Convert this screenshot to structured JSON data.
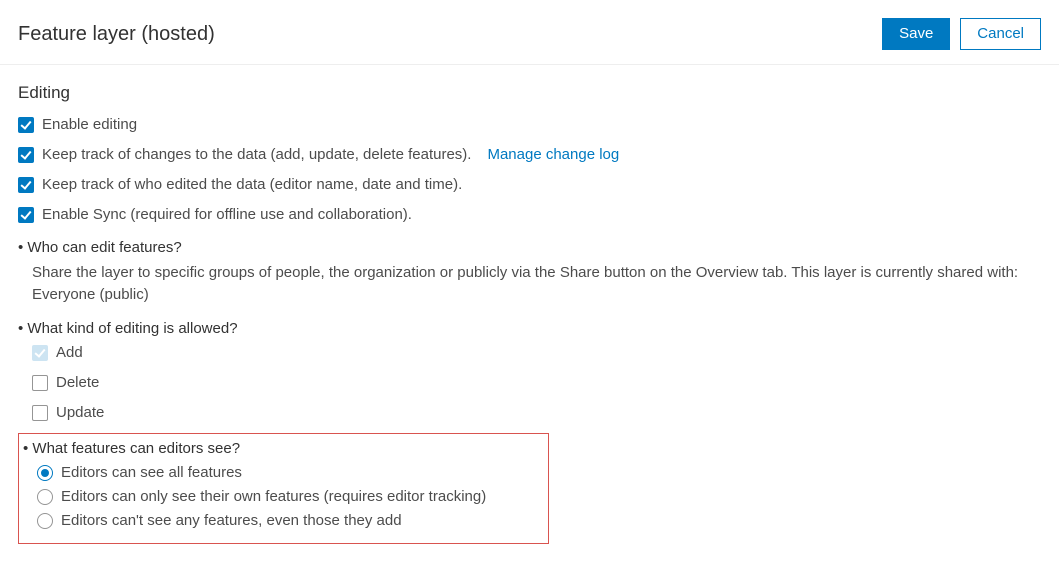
{
  "header": {
    "title": "Feature layer (hosted)",
    "save": "Save",
    "cancel": "Cancel"
  },
  "section_heading": "Editing",
  "checkboxes": {
    "enable_editing": "Enable editing",
    "track_changes": "Keep track of changes to the data (add, update, delete features).",
    "manage_log_link": "Manage change log",
    "track_editors": "Keep track of who edited the data (editor name, date and time).",
    "enable_sync": "Enable Sync (required for offline use and collaboration)."
  },
  "who_can_edit": {
    "title": "Who can edit features?",
    "desc": "Share the layer to specific groups of people, the organization or publicly via the Share button on the Overview tab. This layer is currently shared with: Everyone (public)"
  },
  "editing_kind": {
    "title": "What kind of editing is allowed?",
    "add": "Add",
    "delete": "Delete",
    "update": "Update"
  },
  "visibility": {
    "title": "What features can editors see?",
    "opt_all": "Editors can see all features",
    "opt_own": "Editors can only see their own features (requires editor tracking)",
    "opt_none": "Editors can't see any features, even those they add"
  }
}
